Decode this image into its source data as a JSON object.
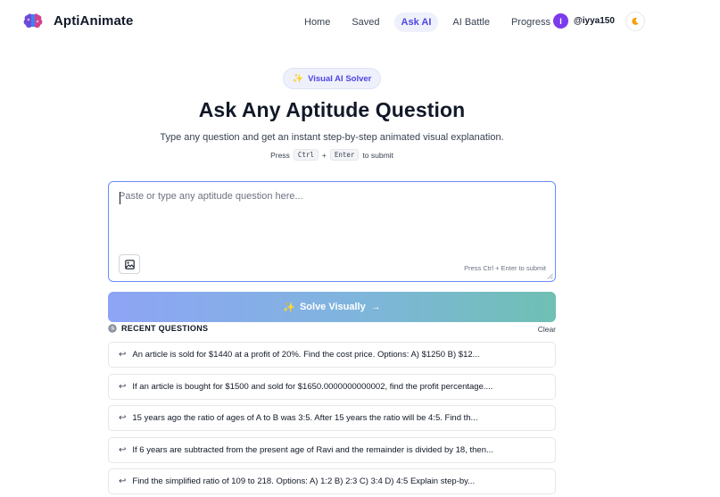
{
  "app": {
    "name": "AptiAnimate",
    "logo_icon": "brain-icon"
  },
  "nav": {
    "items": [
      {
        "label": "Home",
        "active": false
      },
      {
        "label": "Saved",
        "active": false
      },
      {
        "label": "Ask AI",
        "active": true
      },
      {
        "label": "AI Battle",
        "active": false
      },
      {
        "label": "Progress",
        "active": false
      }
    ],
    "user": {
      "avatar_letter": "I",
      "username": "@iyya150"
    },
    "theme_toggle_icon": "moon-icon"
  },
  "hero": {
    "badge": {
      "icon": "sparkles-icon",
      "label": "Visual AI Solver"
    },
    "title": "Ask Any Aptitude Question",
    "subtitle": "Type any question and get an instant step-by-step animated visual explanation.",
    "hint": {
      "prefix": "Press",
      "key1": "Ctrl",
      "plus": "+",
      "key2": "Enter",
      "suffix": "to submit"
    }
  },
  "input": {
    "value": "",
    "placeholder": "Paste or type any aptitude question here...",
    "image_button_icon": "image-icon",
    "submit_hint": "Press Ctrl + Enter to submit"
  },
  "solve_button": {
    "icon": "sparkles-icon",
    "label": "Solve Visually",
    "arrow": "→"
  },
  "recent": {
    "icon": "clock-icon",
    "title": "RECENT QUESTIONS",
    "clear_label": "Clear",
    "item_icon": "return-arrow-icon",
    "items": [
      "An article is sold for $1440 at a profit of 20%. Find the cost price. Options: A) $1250 B) $12...",
      "If an article is bought for $1500 and sold for $1650.0000000000002, find the profit percentage....",
      "15 years ago the ratio of ages of A to B was 3:5. After 15 years the ratio will be 4:5. Find th...",
      "If 6 years are subtracted from the present age of Ravi and the remainder is divided by 18, then...",
      "Find the simplified ratio of 109 to 218. Options: A) 1:2 B) 2:3 C) 3:4 D) 4:5 Explain step-by..."
    ]
  },
  "colors": {
    "accent": "#4f46e5",
    "avatar": "#7c3aed",
    "input_border": "#6b8cff",
    "solve_gradient_start": "#8ea4f5",
    "solve_gradient_end": "#6fc0b3"
  }
}
